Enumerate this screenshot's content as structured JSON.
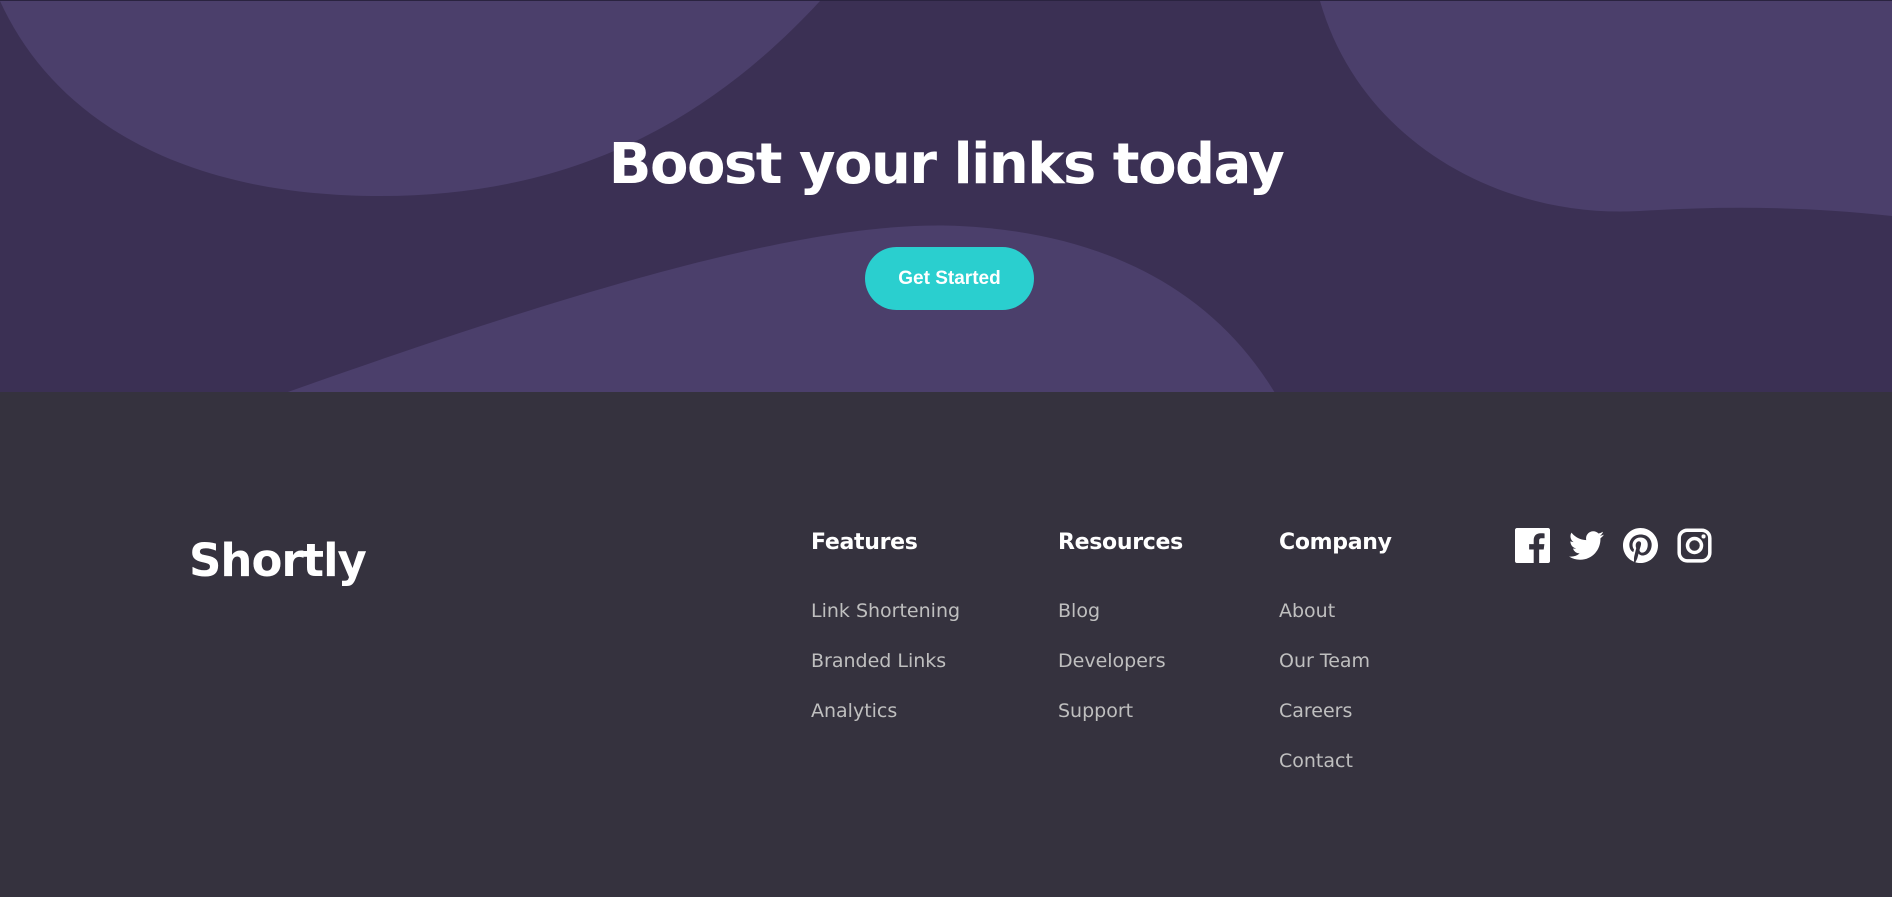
{
  "cta": {
    "title": "Boost your links today",
    "button_label": "Get Started"
  },
  "footer": {
    "logo": "Shortly",
    "columns": [
      {
        "heading": "Features",
        "links": [
          "Link Shortening",
          "Branded Links",
          "Analytics"
        ]
      },
      {
        "heading": "Resources",
        "links": [
          "Blog",
          "Developers",
          "Support"
        ]
      },
      {
        "heading": "Company",
        "links": [
          "About",
          "Our Team",
          "Careers",
          "Contact"
        ]
      }
    ],
    "social": [
      "facebook-icon",
      "twitter-icon",
      "pinterest-icon",
      "instagram-icon"
    ]
  },
  "colors": {
    "boost_background": "#3b3054",
    "boost_shape": "#4b3f6b",
    "accent": "#2acfcf",
    "footer_background": "#35323e",
    "link_text": "#bfbfbf"
  }
}
